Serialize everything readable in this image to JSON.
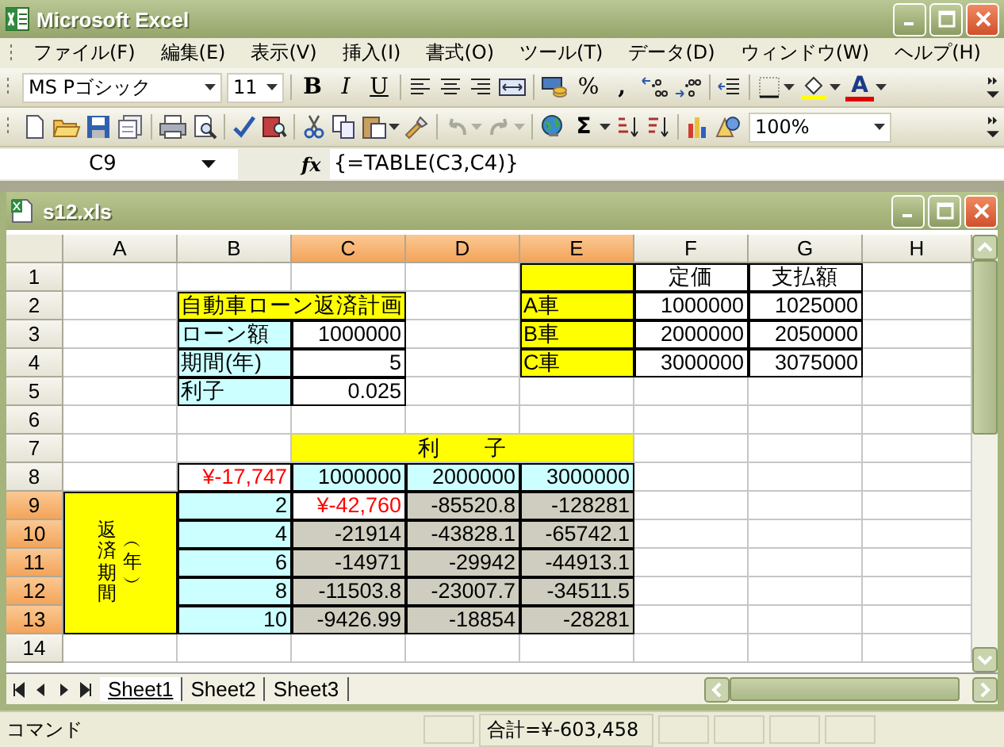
{
  "window": {
    "title": "Microsoft Excel"
  },
  "menu": [
    {
      "label": "ファイル(F)"
    },
    {
      "label": "編集(E)"
    },
    {
      "label": "表示(V)"
    },
    {
      "label": "挿入(I)"
    },
    {
      "label": "書式(O)"
    },
    {
      "label": "ツール(T)"
    },
    {
      "label": "データ(D)"
    },
    {
      "label": "ウィンドウ(W)"
    },
    {
      "label": "ヘルプ(H)"
    }
  ],
  "format_toolbar": {
    "font": "MS Pゴシック",
    "size": "11",
    "bold": "B",
    "italic": "I",
    "underline": "U",
    "percent": "%",
    "comma": ",",
    "font_color": "A"
  },
  "standard_toolbar": {
    "sum": "Σ",
    "zoom": "100%"
  },
  "formula_bar": {
    "name_box": "C9",
    "fx": "fx",
    "formula": "{=TABLE(C3,C4)}"
  },
  "workbook": {
    "title": "s12.xls"
  },
  "columns": [
    {
      "label": "A",
      "selected": false
    },
    {
      "label": "B",
      "selected": false
    },
    {
      "label": "C",
      "selected": true
    },
    {
      "label": "D",
      "selected": true
    },
    {
      "label": "E",
      "selected": true
    },
    {
      "label": "F",
      "selected": false
    },
    {
      "label": "G",
      "selected": false
    },
    {
      "label": "H",
      "selected": false
    }
  ],
  "rows": [
    {
      "label": "1",
      "selected": false,
      "cells": [
        {
          "kind": "empty",
          "selected": false
        },
        {
          "kind": "empty",
          "selected": false
        },
        {
          "kind": "empty",
          "selected": false
        },
        {
          "kind": "empty",
          "selected": false
        },
        {
          "kind": "yellow-label",
          "selected": false
        },
        {
          "kind": "column-title",
          "selected": false,
          "text": "定価"
        },
        {
          "kind": "column-title",
          "selected": false,
          "text": "支払額"
        },
        {
          "kind": "empty",
          "selected": false
        }
      ]
    },
    {
      "label": "2",
      "selected": false,
      "cells": [
        {
          "kind": "empty",
          "selected": false
        },
        {
          "kind": "banner",
          "selected": false,
          "text": "自動車ローン返済計画"
        },
        {
          "kind": "empty",
          "selected": false
        },
        {
          "kind": "yellow-label",
          "selected": false,
          "text": "A車"
        },
        {
          "kind": "value",
          "selected": false,
          "text": "1000000"
        },
        {
          "kind": "value",
          "selected": false,
          "text": "1025000"
        },
        {
          "kind": "empty",
          "selected": false
        }
      ]
    },
    {
      "label": "3",
      "selected": false,
      "cells": [
        {
          "kind": "empty",
          "selected": false
        },
        {
          "kind": "cyan-label",
          "selected": false,
          "text": "ローン額"
        },
        {
          "kind": "value",
          "selected": false,
          "text": "1000000"
        },
        {
          "kind": "empty",
          "selected": false
        },
        {
          "kind": "yellow-label",
          "selected": false,
          "text": "B車"
        },
        {
          "kind": "value",
          "selected": false,
          "text": "2000000"
        },
        {
          "kind": "value",
          "selected": false,
          "text": "2050000"
        },
        {
          "kind": "empty",
          "selected": false
        }
      ]
    },
    {
      "label": "4",
      "selected": false,
      "cells": [
        {
          "kind": "empty",
          "selected": false
        },
        {
          "kind": "cyan-label",
          "selected": false,
          "text": "期間(年)"
        },
        {
          "kind": "value",
          "selected": false,
          "text": "5"
        },
        {
          "kind": "empty",
          "selected": false
        },
        {
          "kind": "yellow-label",
          "selected": false,
          "text": "C車"
        },
        {
          "kind": "value",
          "selected": false,
          "text": "3000000"
        },
        {
          "kind": "value",
          "selected": false,
          "text": "3075000"
        },
        {
          "kind": "empty",
          "selected": false
        }
      ]
    },
    {
      "label": "5",
      "selected": false,
      "cells": [
        {
          "kind": "empty",
          "selected": false
        },
        {
          "kind": "cyan-label",
          "selected": false,
          "text": "利子"
        },
        {
          "kind": "value",
          "selected": false,
          "text": "0.025"
        },
        {
          "kind": "empty",
          "selected": false
        },
        {
          "kind": "empty",
          "selected": false
        },
        {
          "kind": "empty",
          "selected": false
        },
        {
          "kind": "empty",
          "selected": false
        },
        {
          "kind": "empty",
          "selected": false
        }
      ]
    },
    {
      "label": "6",
      "selected": false,
      "cells": [
        {
          "kind": "empty",
          "selected": false
        },
        {
          "kind": "empty",
          "selected": false
        },
        {
          "kind": "empty",
          "selected": false
        },
        {
          "kind": "empty",
          "selected": false
        },
        {
          "kind": "empty",
          "selected": false
        },
        {
          "kind": "empty",
          "selected": false
        },
        {
          "kind": "empty",
          "selected": false
        },
        {
          "kind": "empty",
          "selected": false
        }
      ]
    },
    {
      "label": "7",
      "selected": false,
      "cells": [
        {
          "kind": "empty",
          "selected": false
        },
        {
          "kind": "empty",
          "selected": false
        },
        {
          "kind": "merged-title",
          "selected": false,
          "text": "利　　子"
        },
        {
          "kind": "empty",
          "selected": false
        },
        {
          "kind": "empty",
          "selected": false
        },
        {
          "kind": "empty",
          "selected": false
        }
      ]
    },
    {
      "label": "8",
      "selected": false,
      "cells": [
        {
          "kind": "empty",
          "selected": false
        },
        {
          "kind": "red-value",
          "selected": false,
          "text": "¥-17,747"
        },
        {
          "kind": "cyan-value",
          "selected": false,
          "text": "1000000"
        },
        {
          "kind": "cyan-value",
          "selected": false,
          "text": "2000000"
        },
        {
          "kind": "cyan-value",
          "selected": false,
          "text": "3000000"
        },
        {
          "kind": "empty",
          "selected": false
        },
        {
          "kind": "empty",
          "selected": false
        },
        {
          "kind": "empty",
          "selected": false
        }
      ]
    },
    {
      "label": "9",
      "selected": true,
      "cells": [
        {
          "kind": "side-title",
          "selected": false,
          "vertical_columns": [
            "返済期間",
            "︵年︶"
          ]
        },
        {
          "kind": "cyan-value",
          "selected": false,
          "text": "2"
        },
        {
          "kind": "red-value",
          "selected": false,
          "text": "¥-42,760"
        },
        {
          "kind": "value",
          "selected": true,
          "text": "-85520.8"
        },
        {
          "kind": "value",
          "selected": true,
          "text": "-128281"
        },
        {
          "kind": "empty",
          "selected": false
        },
        {
          "kind": "empty",
          "selected": false
        },
        {
          "kind": "empty",
          "selected": false
        }
      ]
    },
    {
      "label": "10",
      "selected": true,
      "cells": [
        {
          "kind": "cyan-value",
          "selected": false,
          "text": "4"
        },
        {
          "kind": "value",
          "selected": true,
          "text": "-21914"
        },
        {
          "kind": "value",
          "selected": true,
          "text": "-43828.1"
        },
        {
          "kind": "value",
          "selected": true,
          "text": "-65742.1"
        },
        {
          "kind": "empty",
          "selected": false
        },
        {
          "kind": "empty",
          "selected": false
        },
        {
          "kind": "empty",
          "selected": false
        }
      ]
    },
    {
      "label": "11",
      "selected": true,
      "cells": [
        {
          "kind": "cyan-value",
          "selected": false,
          "text": "6"
        },
        {
          "kind": "value",
          "selected": true,
          "text": "-14971"
        },
        {
          "kind": "value",
          "selected": true,
          "text": "-29942"
        },
        {
          "kind": "value",
          "selected": true,
          "text": "-44913.1"
        },
        {
          "kind": "empty",
          "selected": false
        },
        {
          "kind": "empty",
          "selected": false
        },
        {
          "kind": "empty",
          "selected": false
        }
      ]
    },
    {
      "label": "12",
      "selected": true,
      "cells": [
        {
          "kind": "cyan-value",
          "selected": false,
          "text": "8"
        },
        {
          "kind": "value",
          "selected": true,
          "text": "-11503.8"
        },
        {
          "kind": "value",
          "selected": true,
          "text": "-23007.7"
        },
        {
          "kind": "value",
          "selected": true,
          "text": "-34511.5"
        },
        {
          "kind": "empty",
          "selected": false
        },
        {
          "kind": "empty",
          "selected": false
        },
        {
          "kind": "empty",
          "selected": false
        }
      ]
    },
    {
      "label": "13",
      "selected": true,
      "cells": [
        {
          "kind": "cyan-value",
          "selected": false,
          "text": "10"
        },
        {
          "kind": "value",
          "selected": true,
          "text": "-9426.99"
        },
        {
          "kind": "value",
          "selected": true,
          "text": "-18854"
        },
        {
          "kind": "value",
          "selected": true,
          "text": "-28281"
        },
        {
          "kind": "empty",
          "selected": false
        },
        {
          "kind": "empty",
          "selected": false
        },
        {
          "kind": "empty",
          "selected": false
        }
      ]
    },
    {
      "label": "14",
      "selected": false,
      "cells": [
        {
          "kind": "empty",
          "selected": false
        },
        {
          "kind": "empty",
          "selected": false
        },
        {
          "kind": "empty",
          "selected": false
        },
        {
          "kind": "empty",
          "selected": false
        },
        {
          "kind": "empty",
          "selected": false
        },
        {
          "kind": "empty",
          "selected": false
        },
        {
          "kind": "empty",
          "selected": false
        },
        {
          "kind": "empty",
          "selected": false
        }
      ]
    }
  ],
  "sheet_tabs": [
    {
      "label": "Sheet1",
      "selected": true
    },
    {
      "label": "Sheet2",
      "selected": false
    },
    {
      "label": "Sheet3",
      "selected": false
    }
  ],
  "status_bar": {
    "mode": "コマンド",
    "sum": "合計=¥-603,458"
  }
}
